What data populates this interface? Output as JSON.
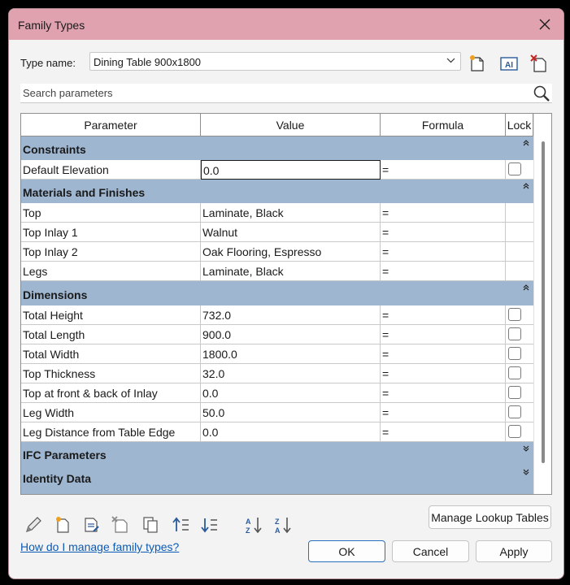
{
  "window": {
    "title": "Family Types"
  },
  "type_name": {
    "label": "Type name:",
    "value": "Dining Table 900x1800"
  },
  "search": {
    "placeholder": "Search parameters"
  },
  "grid": {
    "headers": [
      "Parameter",
      "Value",
      "Formula",
      "Lock"
    ],
    "groups": {
      "constraints": "Constraints",
      "materials": "Materials and Finishes",
      "dimensions": "Dimensions",
      "ifc": "IFC Parameters",
      "identity": "Identity Data"
    },
    "rows": [
      {
        "param": "Default Elevation",
        "value": "0.0",
        "formula": "=",
        "lockable": true,
        "locked": false
      },
      {
        "param": "Top",
        "value": "Laminate, Black",
        "formula": "=",
        "lockable": false
      },
      {
        "param": "Top Inlay 1",
        "value": "Walnut",
        "formula": "=",
        "lockable": false
      },
      {
        "param": "Top Inlay 2",
        "value": "Oak Flooring, Espresso",
        "formula": "=",
        "lockable": false
      },
      {
        "param": "Legs",
        "value": "Laminate, Black",
        "formula": "=",
        "lockable": false
      },
      {
        "param": "Total Height",
        "value": "732.0",
        "formula": "=",
        "lockable": true,
        "locked": false
      },
      {
        "param": "Total Length",
        "value": "900.0",
        "formula": "=",
        "lockable": true,
        "locked": false
      },
      {
        "param": "Total Width",
        "value": "1800.0",
        "formula": "=",
        "lockable": true,
        "locked": false
      },
      {
        "param": "Top Thickness",
        "value": "32.0",
        "formula": "=",
        "lockable": true,
        "locked": false
      },
      {
        "param": "Top at front & back of Inlay",
        "value": "0.0",
        "formula": "=",
        "lockable": true,
        "locked": false
      },
      {
        "param": "Leg Width",
        "value": "50.0",
        "formula": "=",
        "lockable": true,
        "locked": false
      },
      {
        "param": "Leg Distance from Table Edge",
        "value": "0.0",
        "formula": "=",
        "lockable": true,
        "locked": false
      }
    ]
  },
  "buttons": {
    "manage_lookup": "Manage Lookup Tables",
    "ok": "OK",
    "cancel": "Cancel",
    "apply": "Apply"
  },
  "help_link": "How do I manage family types?",
  "colors": {
    "titlebar": "#dfa2ae",
    "group_header": "#9eb6d0",
    "link": "#0b5bb5",
    "primary_border": "#2a6fbf"
  },
  "icons": {
    "toolbar": [
      "new-type-icon",
      "rename-type-icon",
      "delete-type-icon"
    ],
    "bottom": [
      "edit-parameter-icon",
      "new-parameter-icon",
      "edit-parameter-properties-icon",
      "delete-parameter-icon",
      "copy-parameter-icon",
      "move-up-icon",
      "move-down-icon",
      "sort-ascending-icon",
      "sort-descending-icon"
    ]
  }
}
